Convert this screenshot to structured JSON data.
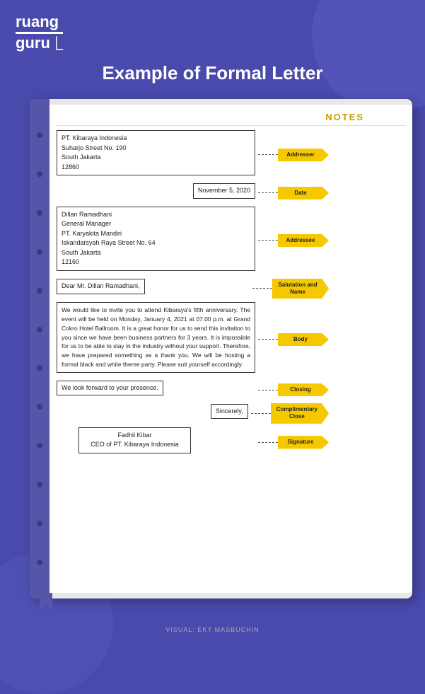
{
  "logo": {
    "line1": "ruang",
    "line2": "guru"
  },
  "title": "Example of Formal Letter",
  "notes_label": "NOTES",
  "letter": {
    "addresser": {
      "lines": [
        "PT. Kibaraya Indonesia",
        "Suharjo Street No. 190",
        "South Jakarta",
        "12860"
      ],
      "label": "Addresser"
    },
    "date": {
      "value": "November 5, 2020",
      "label": "Date"
    },
    "addressee": {
      "lines": [
        "Dillan Ramadhani",
        "General Manager",
        "PT. Karyakita Mandiri",
        "Iskandarsyah Raya Street No. 64",
        "South Jakarta",
        "12160"
      ],
      "label": "Addressee"
    },
    "salutation": {
      "value": "Dear Mr. Dillan Ramadhani,",
      "label": "Salutation and\nName"
    },
    "body": {
      "text": "We would like to invite you to attend Kibaraya's fifth anniversary. The event will be held on Monday, January 4, 2021 at 07.00 p.m. at Grand Cokro Hotel Ballroom. It is a great honor for us to send this invitation to you since we have been business partners for 3 years. It is impossible for us to be able to stay in the industry without your support. Therefore, we have prepared something as a thank you. We will be hosting a formal black and white theme party. Please suit yourself accordingly.",
      "label": "Body"
    },
    "closing": {
      "value": "We look forward to your presence.",
      "label": "Closing"
    },
    "complimentary": {
      "value": "Sincerely,",
      "label": "Complimentary\nClose"
    },
    "signature": {
      "lines": [
        "Fadhil Kibar",
        "CEO of PT. Kibaraya Indonesia"
      ],
      "label": "Signature"
    }
  },
  "footer": "VISUAL: EKY MASBUCHIN"
}
